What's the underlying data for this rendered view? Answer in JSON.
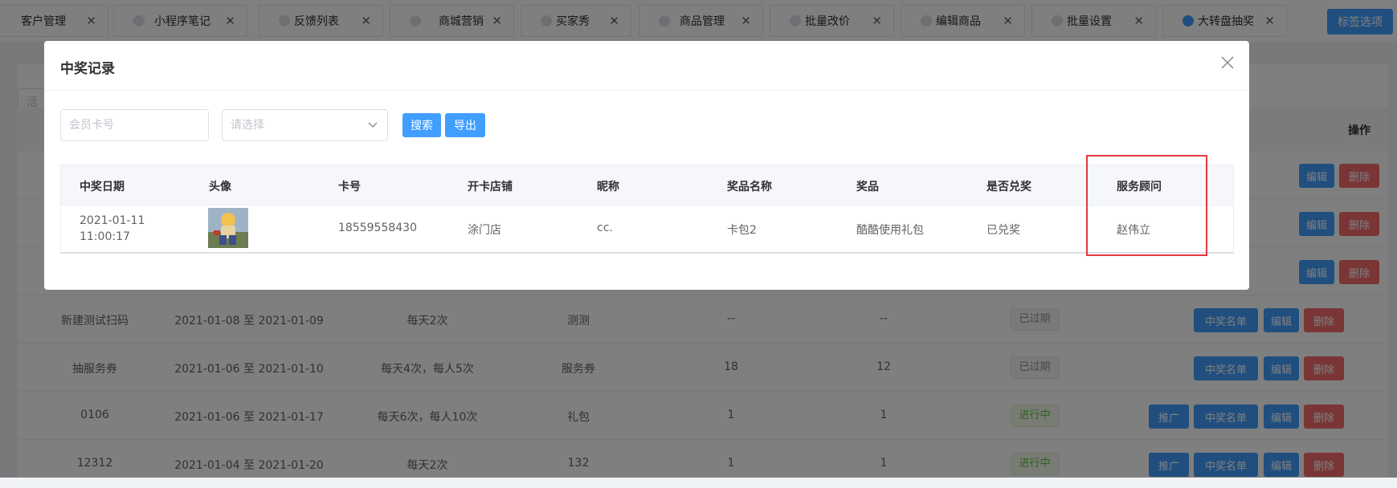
{
  "tabs": [
    {
      "label": "客户管理"
    },
    {
      "label": "小程序笔记"
    },
    {
      "label": "反馈列表"
    },
    {
      "label": "商城营销"
    },
    {
      "label": "买家秀"
    },
    {
      "label": "商品管理"
    },
    {
      "label": "批量改价"
    },
    {
      "label": "编辑商品"
    },
    {
      "label": "批量设置"
    },
    {
      "label": "大转盘抽奖",
      "active": true
    }
  ],
  "tab_options_label": "标签选项",
  "background": {
    "search_placeholder": "活",
    "op_header": "操作",
    "rows": [
      {
        "name": "新建测试扫码",
        "date": "2021-01-08 至 2021-01-09",
        "freq": "每天2次",
        "prize": "测测",
        "a": "--",
        "b": "--",
        "status": "已过期",
        "status_type": "expired",
        "buttons": [
          "中奖名单",
          "编辑",
          "删除"
        ]
      },
      {
        "name": "抽服务券",
        "date": "2021-01-06 至 2021-01-10",
        "freq": "每天4次，每人5次",
        "prize": "服务券",
        "a": "18",
        "b": "12",
        "status": "已过期",
        "status_type": "expired",
        "buttons": [
          "中奖名单",
          "编辑",
          "删除"
        ]
      },
      {
        "name": "0106",
        "date": "2021-01-06 至 2021-01-17",
        "freq": "每天6次，每人10次",
        "prize": "礼包",
        "a": "1",
        "b": "1",
        "status": "进行中",
        "status_type": "running",
        "buttons": [
          "推广",
          "中奖名单",
          "编辑",
          "删除"
        ]
      },
      {
        "name": "12312",
        "date": "2021-01-04 至 2021-01-20",
        "freq": "每天2次",
        "prize": "132",
        "a": "1",
        "b": "1",
        "status": "进行中",
        "status_type": "running",
        "buttons": [
          "推广",
          "中奖名单",
          "编辑",
          "删除"
        ]
      }
    ],
    "top_row_buttons": [
      "编辑",
      "删除"
    ]
  },
  "modal": {
    "title": "中奖记录",
    "card_placeholder": "会员卡号",
    "select_placeholder": "请选择",
    "search_label": "搜索",
    "export_label": "导出",
    "columns": [
      "中奖日期",
      "头像",
      "卡号",
      "开卡店铺",
      "昵称",
      "奖品名称",
      "奖品",
      "是否兑奖",
      "服务顾问"
    ],
    "rows": [
      {
        "date": "2021-01-11 11:00:17",
        "card": "18559558430",
        "store": "涂门店",
        "nickname": "cc.",
        "prize_name": "卡包2",
        "prize": "酷酷使用礼包",
        "redeemed": "已兑奖",
        "advisor": "赵伟立"
      }
    ]
  },
  "colors": {
    "primary": "#409eff",
    "danger": "#f56c6c",
    "success": "#67c23a",
    "highlight": "#e4393c"
  }
}
